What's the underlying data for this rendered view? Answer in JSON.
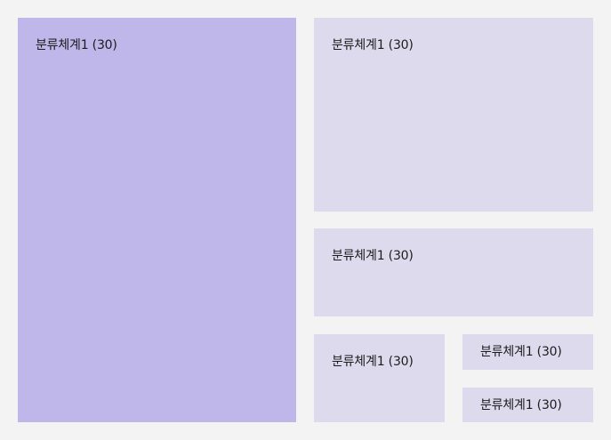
{
  "colors": {
    "background": "#f3f3f3",
    "tile_primary": "#bfb6e9",
    "tile_secondary": "#dedaee",
    "text": "#1c1c1c"
  },
  "treemap": {
    "tiles": [
      {
        "label": "분류체계1 (30)",
        "selected": true
      },
      {
        "label": "분류체계1 (30)",
        "selected": false
      },
      {
        "label": "분류체계1 (30)",
        "selected": false
      },
      {
        "label": "분류체계1 (30)",
        "selected": false
      },
      {
        "label": "분류체계1 (30)",
        "selected": false
      },
      {
        "label": "분류체계1 (30)",
        "selected": false
      }
    ]
  }
}
